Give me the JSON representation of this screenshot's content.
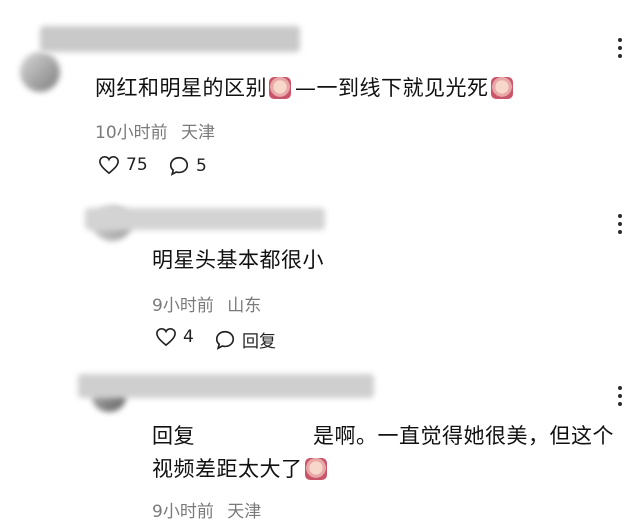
{
  "comments": [
    {
      "text_part1": "网红和明星的区别",
      "text_part2": "一到线下就见光死",
      "time": "10小时前",
      "location": "天津",
      "likes": "75",
      "replies": "5"
    },
    {
      "text": "明星头基本都很小",
      "time": "9小时前",
      "location": "山东",
      "likes": "4",
      "reply_label": "回复"
    },
    {
      "reply_prefix": "回复",
      "line1_rest": "是啊。一直觉得她很美，但这个",
      "line2": "视频差距太大了",
      "time": "9小时前",
      "location": "天津"
    }
  ],
  "icons": {
    "more": "more-options-icon",
    "like": "heart-icon",
    "reply": "comment-bubble-icon",
    "emoji": "crying-laughing-emoji"
  },
  "colors": {
    "meta_text": "#7a7a7a",
    "blurred_name": "#c9c9c9"
  }
}
